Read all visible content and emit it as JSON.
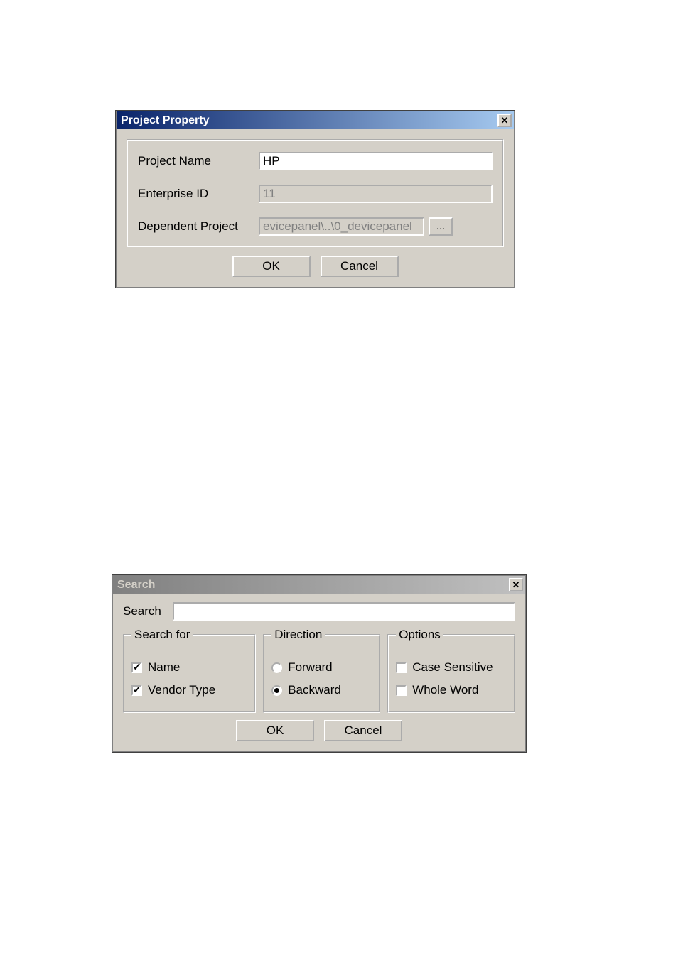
{
  "projectProperty": {
    "title": "Project Property",
    "fields": {
      "projectName": {
        "label": "Project Name",
        "value": "HP",
        "editable": true
      },
      "enterpriseId": {
        "label": "Enterprise ID",
        "value": "11",
        "editable": false
      },
      "dependentProject": {
        "label": "Dependent Project",
        "value": "evicepanel\\..\\0_devicepanel",
        "editable": false,
        "browse": "..."
      }
    },
    "buttons": {
      "ok": "OK",
      "cancel": "Cancel"
    }
  },
  "search": {
    "title": "Search",
    "searchLabel": "Search",
    "searchValue": "",
    "searchFor": {
      "legend": "Search for",
      "name": {
        "label": "Name",
        "checked": true
      },
      "vendorType": {
        "label": "Vendor Type",
        "checked": true
      }
    },
    "direction": {
      "legend": "Direction",
      "forward": {
        "label": "Forward",
        "checked": false
      },
      "backward": {
        "label": "Backward",
        "checked": true
      }
    },
    "options": {
      "legend": "Options",
      "caseSensitive": {
        "label": "Case Sensitive",
        "checked": false
      },
      "wholeWord": {
        "label": "Whole Word",
        "checked": false
      }
    },
    "buttons": {
      "ok": "OK",
      "cancel": "Cancel"
    }
  }
}
